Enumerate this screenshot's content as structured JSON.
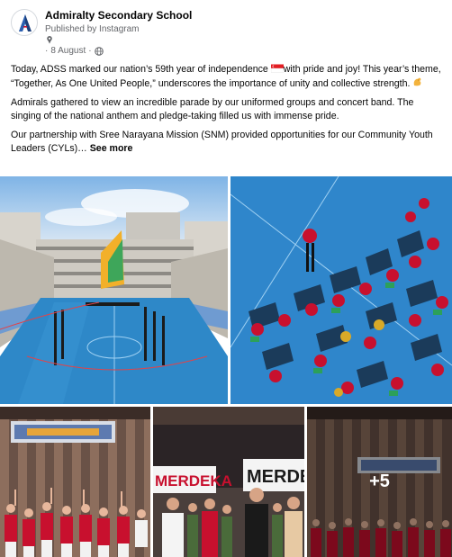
{
  "post": {
    "page_name": "Admiralty Secondary School",
    "published_by": "Published by Instagram",
    "date": "8 August",
    "separator": "·",
    "icons": [
      "pin-icon",
      "globe-icon",
      "flag-emoji-icon",
      "flexed-arm-emoji-icon"
    ],
    "paragraphs": {
      "p1_before_emoji": "Today, ADSS marked our nation’s 59th year of independence ",
      "p1_after_emoji": "with pride and joy! This year’s theme, “Together, As One United People,” underscores the importance of unity and collective strength. ",
      "p2": "Admirals gathered to view an incredible parade by our uniformed groups and concert band. The singing of the national anthem and pledge-taking filled us with immense pride.",
      "p3": "Our partnership with Sree Narayana Mission (SNM) provided opportunities for our Community Youth Leaders (CYLs)… "
    },
    "see_more": "See more"
  },
  "photos": {
    "banner_merdeka": "MERDEKA",
    "banner_merdeka_2": "MERDE",
    "more_count": "+5"
  },
  "colors": {
    "secondary_text": "#65676b",
    "flag_red": "#e31d23",
    "court_blue": "#2e88c8",
    "shirt_red": "#c8102e"
  }
}
